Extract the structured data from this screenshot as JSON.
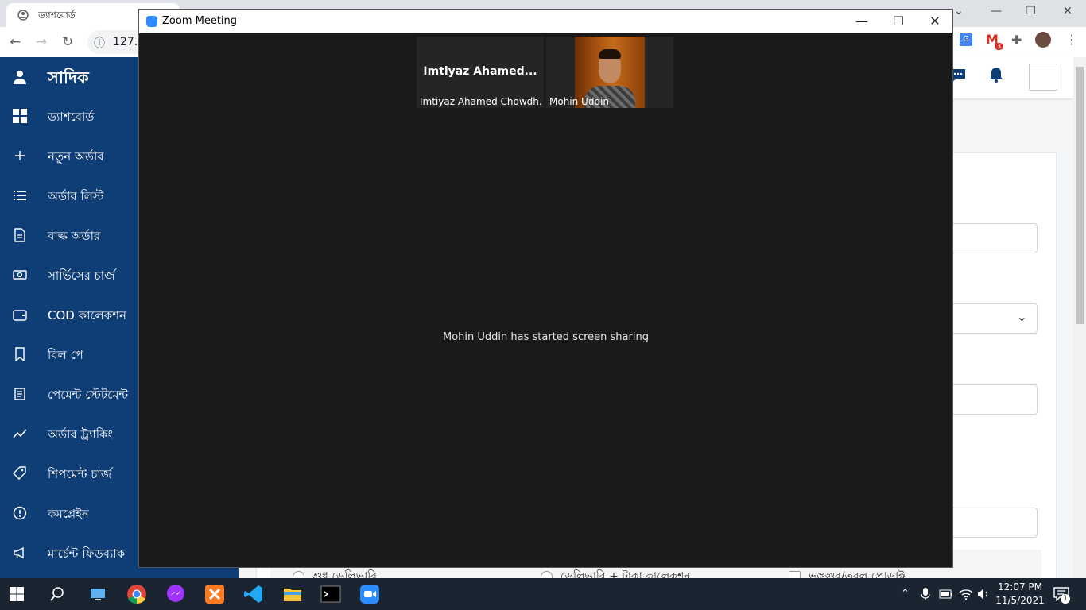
{
  "browser": {
    "tab_title": "ড্যাশবোর্ড",
    "url": "127.0",
    "gmail_badge": "3"
  },
  "sidebar": {
    "user_name": "সাদিক",
    "items": [
      {
        "label": "ড্যাশবোর্ড",
        "icon": "dashboard-grid-icon"
      },
      {
        "label": "নতুন অর্ডার",
        "icon": "plus-icon"
      },
      {
        "label": "অর্ডার লিস্ট",
        "icon": "list-icon"
      },
      {
        "label": "বাল্ক অর্ডার",
        "icon": "document-icon"
      },
      {
        "label": "সার্ভিসের চার্জ",
        "icon": "money-icon"
      },
      {
        "label": "COD কালেকশন",
        "icon": "wallet-icon"
      },
      {
        "label": "বিল পে",
        "icon": "bookmark-icon"
      },
      {
        "label": "পেমেন্ট স্টেটমেন্ট",
        "icon": "statement-icon"
      },
      {
        "label": "অর্ডার ট্র্যাকিং",
        "icon": "trend-line-icon"
      },
      {
        "label": "শিপমেন্ট চার্জ",
        "icon": "tag-icon"
      },
      {
        "label": "কমপ্লেইন",
        "icon": "alert-circle-icon"
      },
      {
        "label": "মার্চেন্ট ফিডব্যাক",
        "icon": "megaphone-icon"
      }
    ]
  },
  "form_options": {
    "opt1": "শুধু ডেলিভারি",
    "opt2": "ডেলিভারি + টাকা কালেকশন",
    "opt3": "ভঙ্গুর/তরল প্রোডাক্ট"
  },
  "zoom": {
    "window_title": "Zoom Meeting",
    "participants": [
      {
        "display": "Imtiyaz  Ahamed...",
        "caption": "Imtiyaz Ahamed Chowdh..."
      },
      {
        "display": "",
        "caption": "Mohin Uddin"
      }
    ],
    "message": "Mohin Uddin has started screen sharing"
  },
  "taskbar": {
    "time": "12:07 PM",
    "date": "11/5/2021",
    "notification_count": "1"
  }
}
